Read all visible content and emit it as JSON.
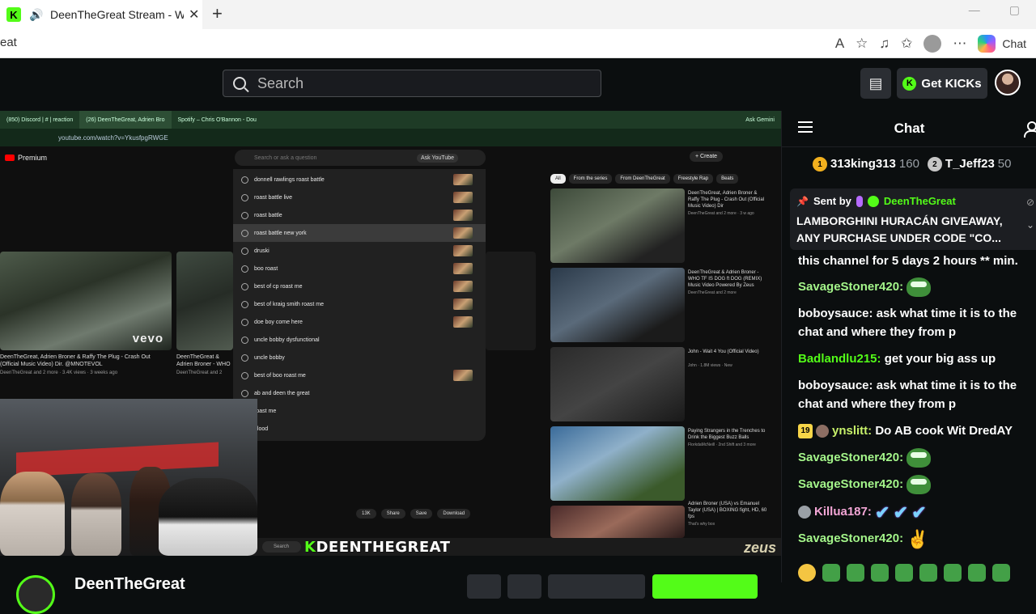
{
  "browser": {
    "tab_title": "DeenTheGreat Stream - Watch",
    "new_tab": "+",
    "url_fragment": "eat",
    "copilot_label": "Chat",
    "favicon": "K"
  },
  "header": {
    "search_placeholder": "Search",
    "get_kicks": "Get KICKs",
    "kicks_logo": "K"
  },
  "video": {
    "inner_tabs": [
      "(850) Discord | # | reaction",
      "(26) DeenTheGreat, Adrien Bro",
      "Spotify – Chris O'Bannon - Dou"
    ],
    "inner_url": "youtube.com/watch?v=YkusfpgRWGE",
    "ask_gemini": "Ask Gemini",
    "yt_premium": "Premium",
    "yt_search_placeholder": "Search or ask a question",
    "ask_youtube": "Ask YouTube",
    "create": "+ Create",
    "suggestions": [
      "donnell rawlings roast battle",
      "roast battle live",
      "roast battle",
      "roast battle new york",
      "druski",
      "boo roast",
      "best of cp roast me",
      "best of kraig smith roast me",
      "doe boy come here",
      "uncle bobby dysfunctional",
      "uncle bobby",
      "best of boo roast me",
      "ab and deen the great",
      "roast me",
      "blood"
    ],
    "main_video_title": "DeenTheGreat, Adrien Broner & Raffy The Plug - Crash Out (Official Music Video) Dir. @MNOTEVOL",
    "main_video_meta": "DeenTheGreat and 2 more · 3.4K views · 3 weeks ago",
    "second_video_title": "DeenTheGreat & Adrien Broner - WHO TF IS DOG Music Video Powered By",
    "second_video_meta": "DeenTheGreat and 2 more · 1.4M views",
    "vevo": "vevo",
    "filters": [
      "All",
      "From the series",
      "From DeenTheGreat",
      "Freestyle Rap",
      "Beats"
    ],
    "side_videos": [
      {
        "title": "DeenTheGreat, Adrien Broner & Raffy The Plug - Crash Out (Official Music Video) Dir",
        "meta": "DeenTheGreat and 2 more · 3 w ago"
      },
      {
        "title": "DeenTheGreat & Adrien Broner - WHO TF IS DOG ft DOG (REMIX) Music Video Powered By Zeus",
        "meta": "DeenTheGreat and 2 more"
      },
      {
        "title": "John - Wait 4 You (Official Video)",
        "meta": "John · 1.8M views · New"
      },
      {
        "title": "Paying Strangers in the Trenches to Drink the Biggest Buzz Balls",
        "meta": "FlorkdaMcNeill · 2nd Shift and 3 more"
      },
      {
        "title": "Adrien Broner (USA) vs Emanuel Taylor (USA) | BOXING fight, HD, 60 fps",
        "meta": "That's why box"
      }
    ],
    "actions": [
      "13K",
      "Share",
      "Save",
      "Download"
    ],
    "taskbar_search": "Search",
    "overlay_k": "K",
    "overlay_name": "DEENTHEGREAT",
    "zeus": "zeus"
  },
  "below": {
    "channel_name": "DeenTheGreat"
  },
  "chat": {
    "title": "Chat",
    "leaderboard": [
      {
        "rank": "1",
        "user": "313king313",
        "count": "160"
      },
      {
        "rank": "2",
        "user": "T_Jeff23",
        "count": "50"
      }
    ],
    "pinned": {
      "sent_by": "Sent by",
      "user": "DeenTheGreat",
      "line1": "LAMBORGHINI HURACÁN GIVEAWAY,",
      "line2": "ANY PURCHASE UNDER CODE \"CO..."
    },
    "messages": [
      {
        "text": "this channel for 5 days 2 hours ** min."
      },
      {
        "user": "SavageStoner420:",
        "text": ""
      },
      {
        "user": "boboysauce:",
        "text": " ask what time it is to the chat and where they from p"
      },
      {
        "user": "Badlandlu215:",
        "text": " get your big ass up"
      },
      {
        "user": "boboysauce:",
        "text": " ask what time it is to the chat and where they from p"
      },
      {
        "badge": "19",
        "user": "ynslitt:",
        "text": " Do AB cook Wit DredAY"
      },
      {
        "user": "SavageStoner420:",
        "text": ""
      },
      {
        "user": "SavageStoner420:",
        "text": ""
      },
      {
        "user": "Killua187:",
        "text": ""
      },
      {
        "user": "SavageStoner420:",
        "text": ""
      }
    ]
  }
}
